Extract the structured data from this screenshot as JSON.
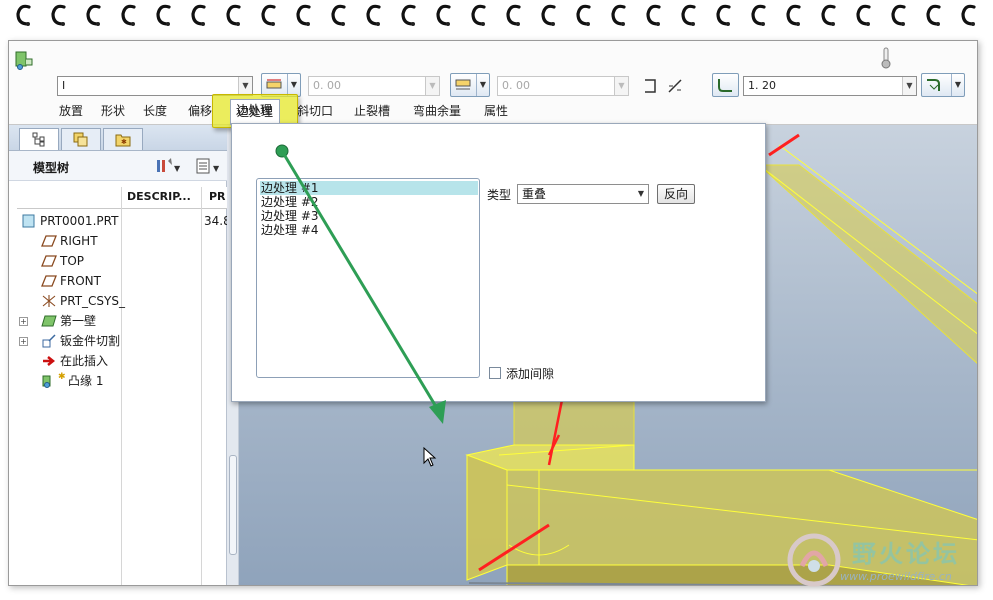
{
  "dashboard": {
    "section_select": "I",
    "thickness_value": "0. 00",
    "offset_value": "0. 00",
    "radius_value": "1. 20"
  },
  "tabs": [
    {
      "label": "放置"
    },
    {
      "label": "形状"
    },
    {
      "label": "长度"
    },
    {
      "label": "偏移"
    },
    {
      "label": "边处理"
    },
    {
      "label": "斜切口"
    },
    {
      "label": "止裂槽"
    },
    {
      "label": "弯曲余量"
    },
    {
      "label": "属性"
    }
  ],
  "left_panel": {
    "title": "模型树",
    "columns": [
      "DESCRIP...",
      "PR"
    ],
    "items": [
      {
        "label": "PRT0001.PRT",
        "value": "34.8",
        "icon": "part-icon"
      },
      {
        "label": "RIGHT",
        "icon": "datum-plane-icon"
      },
      {
        "label": "TOP",
        "icon": "datum-plane-icon"
      },
      {
        "label": "FRONT",
        "icon": "datum-plane-icon"
      },
      {
        "label": "PRT_CSYS_",
        "icon": "csys-icon"
      },
      {
        "label": "第一壁",
        "icon": "wall-icon"
      },
      {
        "label": "钣金件切割",
        "icon": "cut-icon"
      },
      {
        "label": "在此插入",
        "icon": "insert-arrow-icon"
      },
      {
        "label": "凸缘 1",
        "icon": "flange-icon"
      }
    ]
  },
  "edge_panel": {
    "list": [
      "边处理 #1",
      "边处理 #2",
      "边处理 #3",
      "边处理 #4"
    ],
    "selected_index": 0,
    "type_label": "类型",
    "type_value": "重叠",
    "flip_label": "反向",
    "gap_label": "添加间隙"
  },
  "watermark": {
    "title": "野火论坛",
    "url": "www.proewildfire.cn"
  },
  "colors": {
    "highlight": "#e6e828",
    "arrow": "#2e9e55",
    "selection": "#b7e4ea"
  }
}
